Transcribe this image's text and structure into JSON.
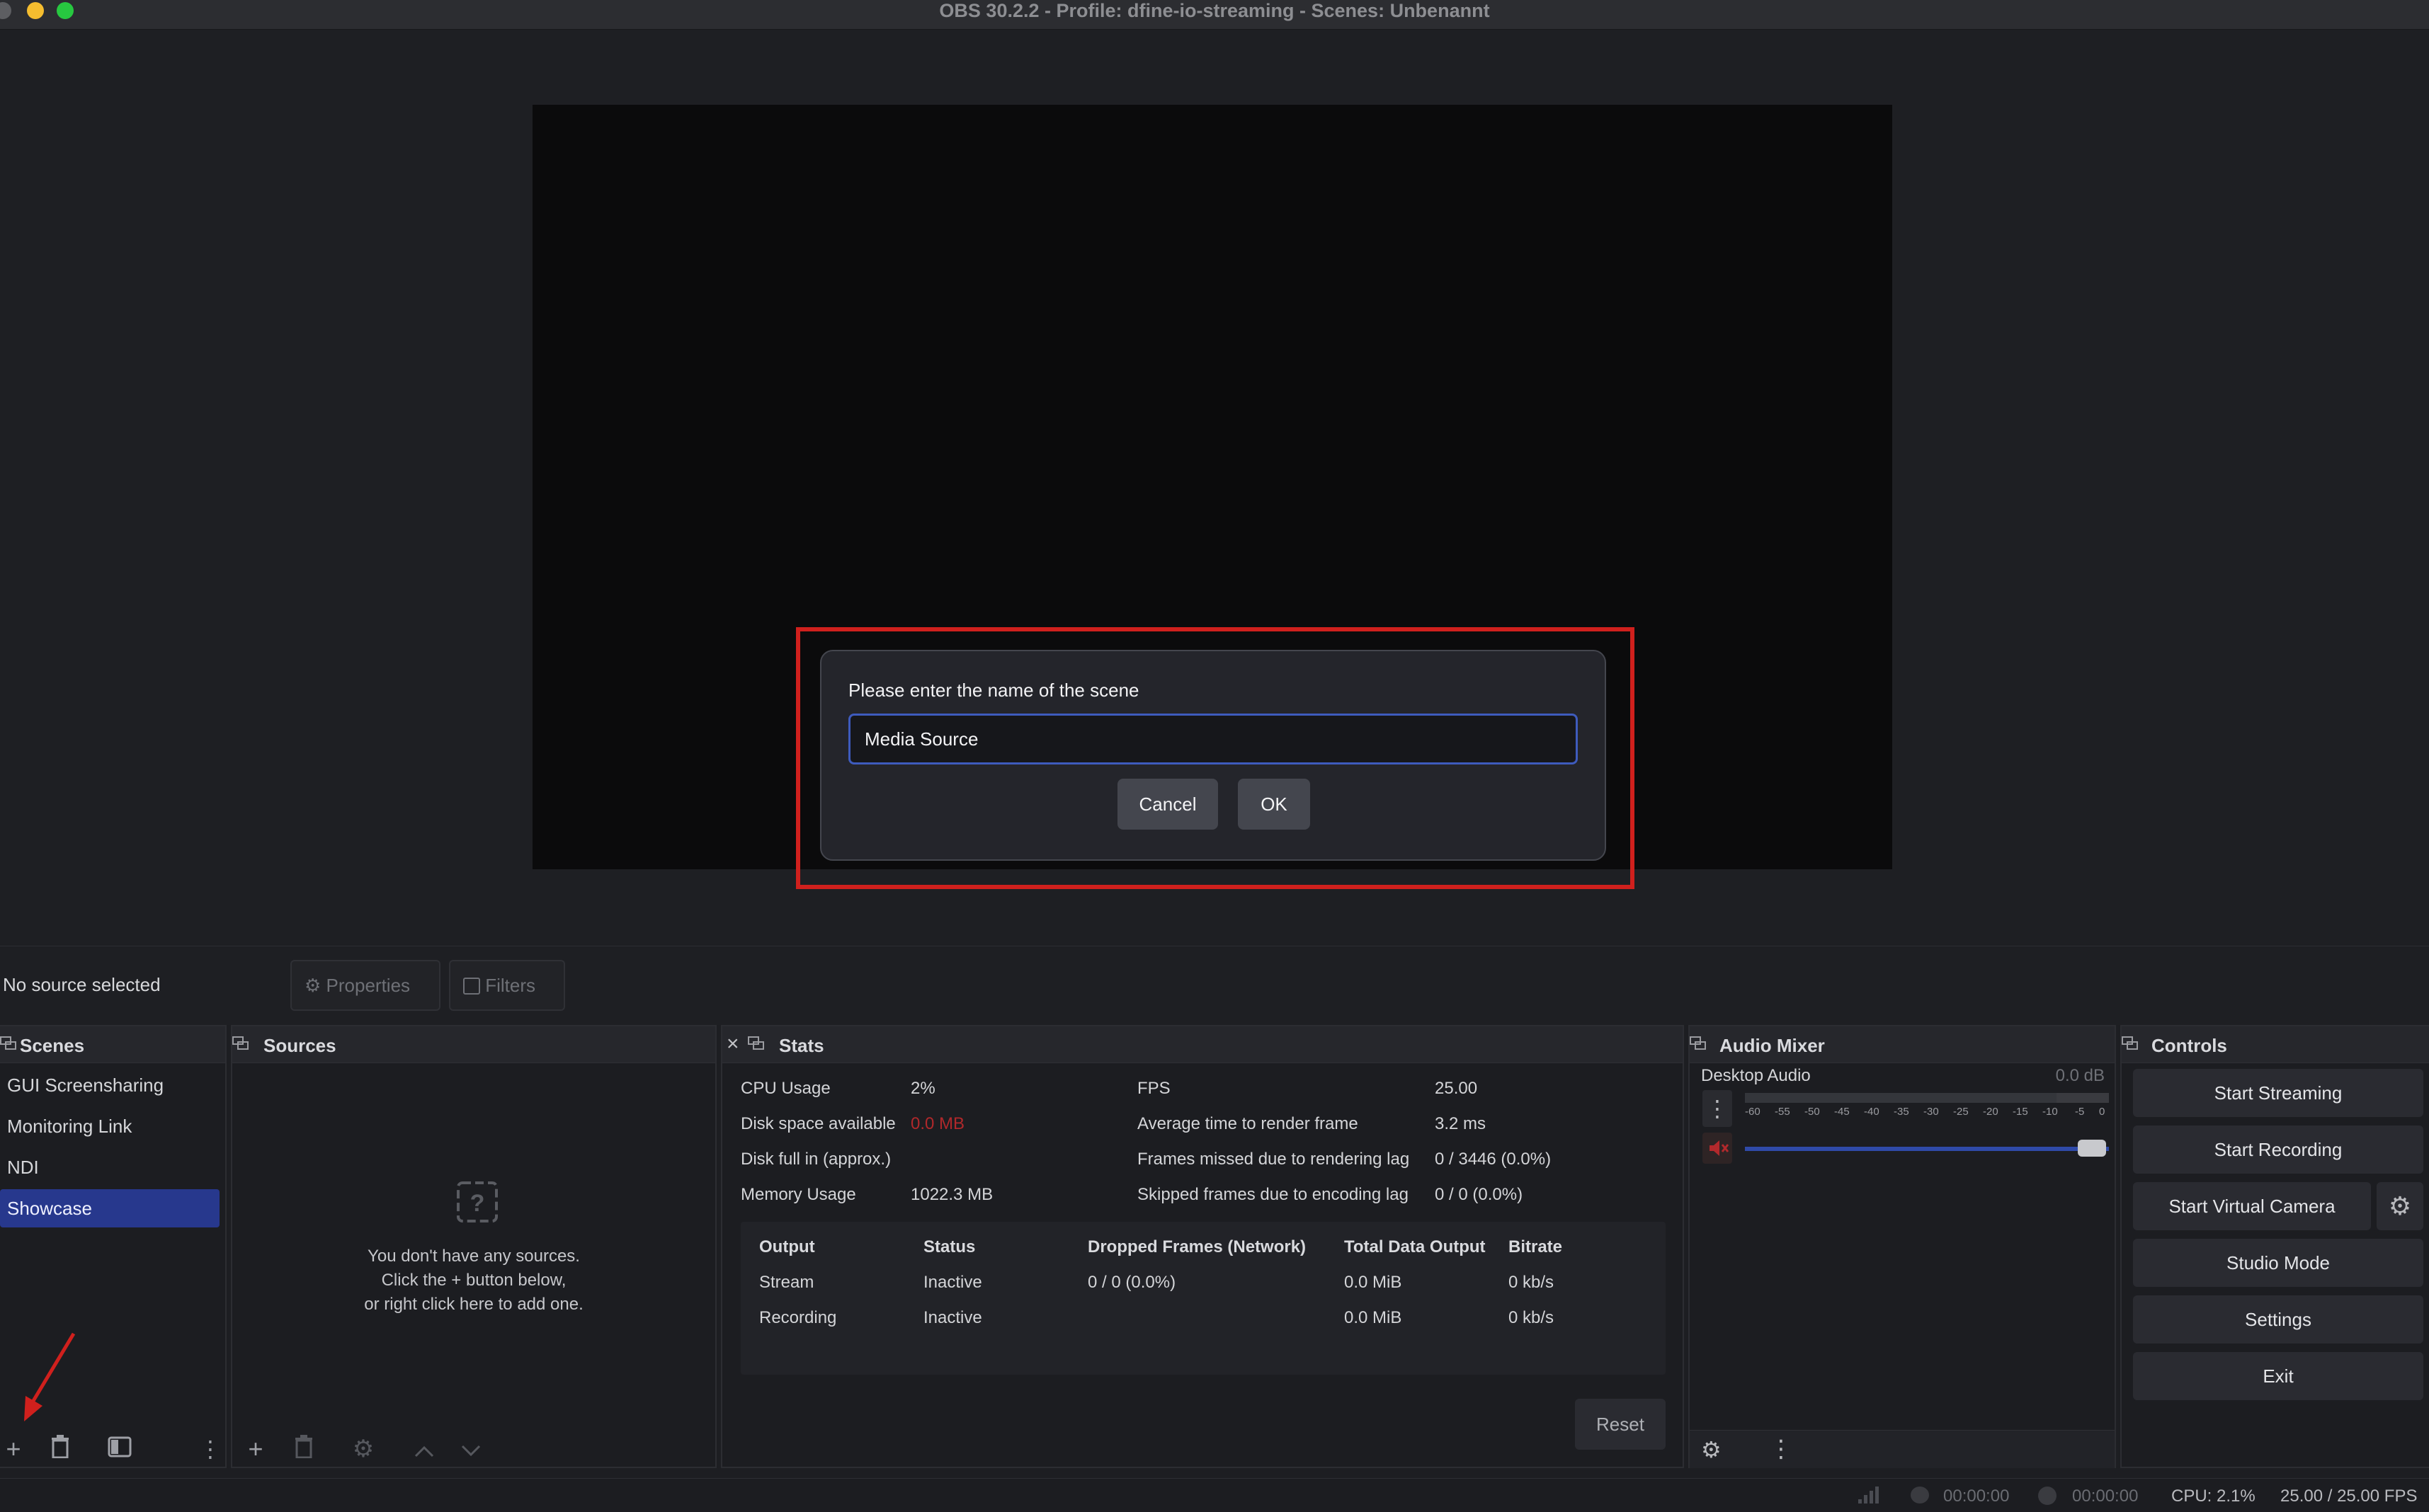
{
  "window": {
    "title": "OBS 30.2.2 - Profile: dfine-io-streaming - Scenes: Unbenannt"
  },
  "dialog": {
    "label": "Please enter the name of the scene",
    "input_value": "Media Source",
    "cancel_label": "Cancel",
    "ok_label": "OK"
  },
  "context": {
    "no_source": "No source selected",
    "properties_label": "Properties",
    "filters_label": "Filters"
  },
  "scenes": {
    "title": "Scenes",
    "items": [
      {
        "label": "GUI Screensharing"
      },
      {
        "label": "Monitoring Link"
      },
      {
        "label": "NDI"
      },
      {
        "label": "Showcase"
      }
    ]
  },
  "sources": {
    "title": "Sources",
    "empty_line1": "You don't have any sources.",
    "empty_line2": "Click the + button below,",
    "empty_line3": "or right click here to add one."
  },
  "stats": {
    "title": "Stats",
    "left": [
      {
        "label": "CPU Usage",
        "value": "2%"
      },
      {
        "label": "Disk space available",
        "value": "0.0 MB"
      },
      {
        "label": "Disk full in (approx.)",
        "value": ""
      },
      {
        "label": "Memory Usage",
        "value": "1022.3 MB"
      }
    ],
    "right": [
      {
        "label": "FPS",
        "value": "25.00"
      },
      {
        "label": "Average time to render frame",
        "value": "3.2 ms"
      },
      {
        "label": "Frames missed due to rendering lag",
        "value": "0 / 3446 (0.0%)"
      },
      {
        "label": "Skipped frames due to encoding lag",
        "value": "0 / 0 (0.0%)"
      }
    ],
    "table": {
      "headers": [
        "Output",
        "Status",
        "Dropped Frames (Network)",
        "Total Data Output",
        "Bitrate"
      ],
      "rows": [
        [
          "Stream",
          "Inactive",
          "0 / 0 (0.0%)",
          "0.0 MiB",
          "0 kb/s"
        ],
        [
          "Recording",
          "Inactive",
          "",
          "0.0 MiB",
          "0 kb/s"
        ]
      ]
    },
    "reset_label": "Reset",
    "warning_color": "#b0282b"
  },
  "audio": {
    "title": "Audio Mixer",
    "channel": "Desktop Audio",
    "db": "0.0 dB",
    "ticks": [
      "-60",
      "-55",
      "-50",
      "-45",
      "-40",
      "-35",
      "-30",
      "-25",
      "-20",
      "-15",
      "-10",
      "-5",
      "0"
    ]
  },
  "controls": {
    "title": "Controls",
    "start_streaming": "Start Streaming",
    "start_recording": "Start Recording",
    "start_virtual_camera": "Start Virtual Camera",
    "studio_mode": "Studio Mode",
    "settings": "Settings",
    "exit": "Exit"
  },
  "status": {
    "stream_time": "00:00:00",
    "record_time": "00:00:00",
    "cpu": "CPU: 2.1%",
    "fps": "25.00 / 25.00 FPS"
  },
  "colors": {
    "accent": "#3e5bbd",
    "highlight": "#d0201d",
    "selected": "#27388d"
  }
}
